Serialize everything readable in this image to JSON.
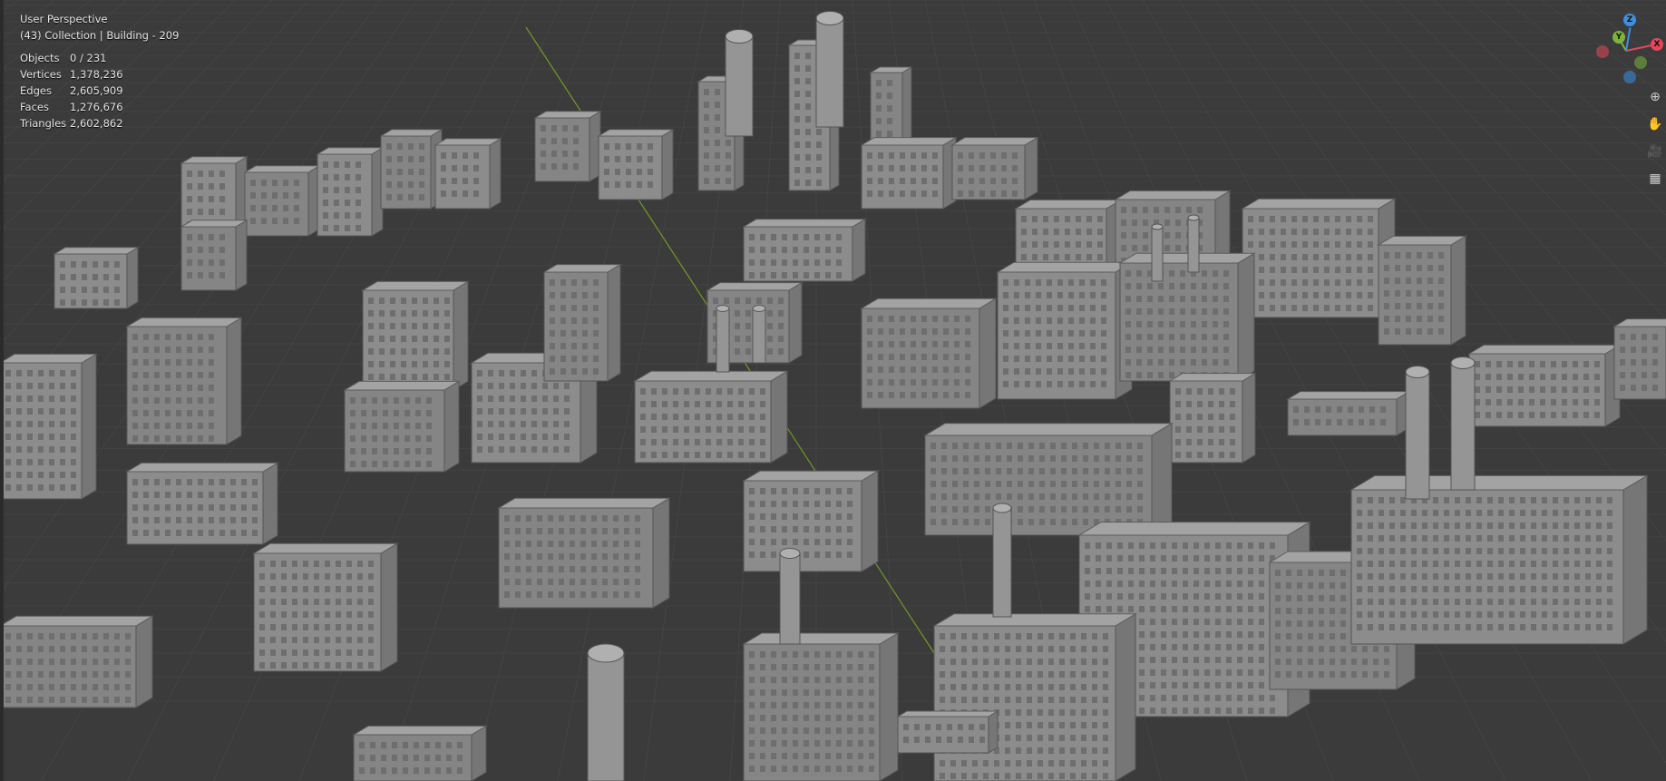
{
  "viewport": {
    "view_name": "User Perspective",
    "collection_line": "(43) Collection | Building - 209"
  },
  "stats": [
    {
      "label": "Objects",
      "value": "0 / 231"
    },
    {
      "label": "Vertices",
      "value": "1,378,236"
    },
    {
      "label": "Edges",
      "value": "2,605,909"
    },
    {
      "label": "Faces",
      "value": "1,276,676"
    },
    {
      "label": "Triangles",
      "value": "2,602,862"
    }
  ],
  "gizmo": {
    "x_label": "X",
    "y_label": "Y",
    "z_label": "Z",
    "colors": {
      "x": "#e5475a",
      "y": "#7cb33c",
      "z": "#3d8fe0"
    }
  },
  "nav_tools": [
    {
      "name": "zoom-icon",
      "glyph": "⊕"
    },
    {
      "name": "pan-hand-icon",
      "glyph": "✋"
    },
    {
      "name": "camera-icon",
      "glyph": "🎥"
    },
    {
      "name": "orthographic-grid-icon",
      "glyph": "▦"
    }
  ],
  "colors": {
    "background": "#3b3b3b",
    "grid": "#454545",
    "model": "#8c8c8c",
    "y_axis_line": "#6e8f2a"
  }
}
